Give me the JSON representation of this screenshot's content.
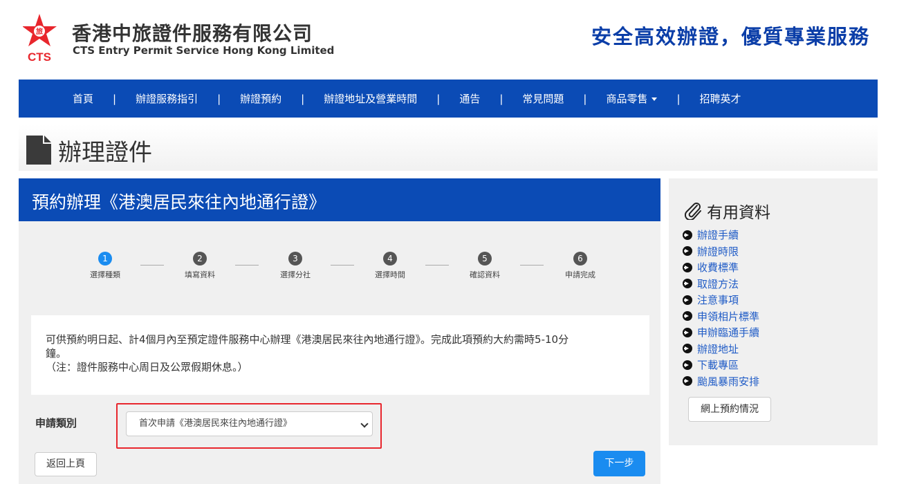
{
  "header": {
    "logo_text": "CTS",
    "company_cn": "香港中旅證件服務有限公司",
    "company_en": "CTS Entry Permit Service Hong Kong Limited",
    "slogan": "安全高效辦證，優質專業服務",
    "brand_color": "#0b4bb5",
    "logo_color": "#e8262d"
  },
  "nav": {
    "items": [
      {
        "label": "首頁"
      },
      {
        "label": "辦證服務指引"
      },
      {
        "label": "辦證預約"
      },
      {
        "label": "辦證地址及營業時間"
      },
      {
        "label": "通告"
      },
      {
        "label": "常見問題"
      },
      {
        "label": "商品零售"
      },
      {
        "label": "招聘英才"
      }
    ],
    "separator": "|"
  },
  "page": {
    "title": "辦理證件"
  },
  "main": {
    "title": "預約辦理《港澳居民來往內地通行證》",
    "steps": [
      {
        "num": "1",
        "label": "選擇種類",
        "active": true
      },
      {
        "num": "2",
        "label": "填寫資料",
        "active": false
      },
      {
        "num": "3",
        "label": "選擇分社",
        "active": false
      },
      {
        "num": "4",
        "label": "選擇時間",
        "active": false
      },
      {
        "num": "5",
        "label": "確認資料",
        "active": false
      },
      {
        "num": "6",
        "label": "申請完成",
        "active": false
      }
    ],
    "info_line1": "可供預約明日起、計4個月內至預定證件服務中心辦理《港澳居民來往內地通行證》。完成此項預約大約需時5-10分",
    "info_line2": "鐘。",
    "info_line3": "（注：證件服務中心周日及公眾假期休息。）",
    "field_label": "申請類別",
    "select_value": "首次申請《港澳居民來往內地通行證》",
    "back_label": "返回上頁",
    "next_label": "下一步"
  },
  "sidebar": {
    "title": "有用資料",
    "items": [
      {
        "label": "辦證手續"
      },
      {
        "label": "辦證時限"
      },
      {
        "label": "收費標準"
      },
      {
        "label": "取證方法"
      },
      {
        "label": "注意事項"
      },
      {
        "label": "申領相片標準"
      },
      {
        "label": "申辦臨通手續"
      },
      {
        "label": "辦證地址"
      },
      {
        "label": "下載專區"
      },
      {
        "label": "颱風暴雨安排"
      }
    ],
    "button_label": "網上預約情況"
  }
}
